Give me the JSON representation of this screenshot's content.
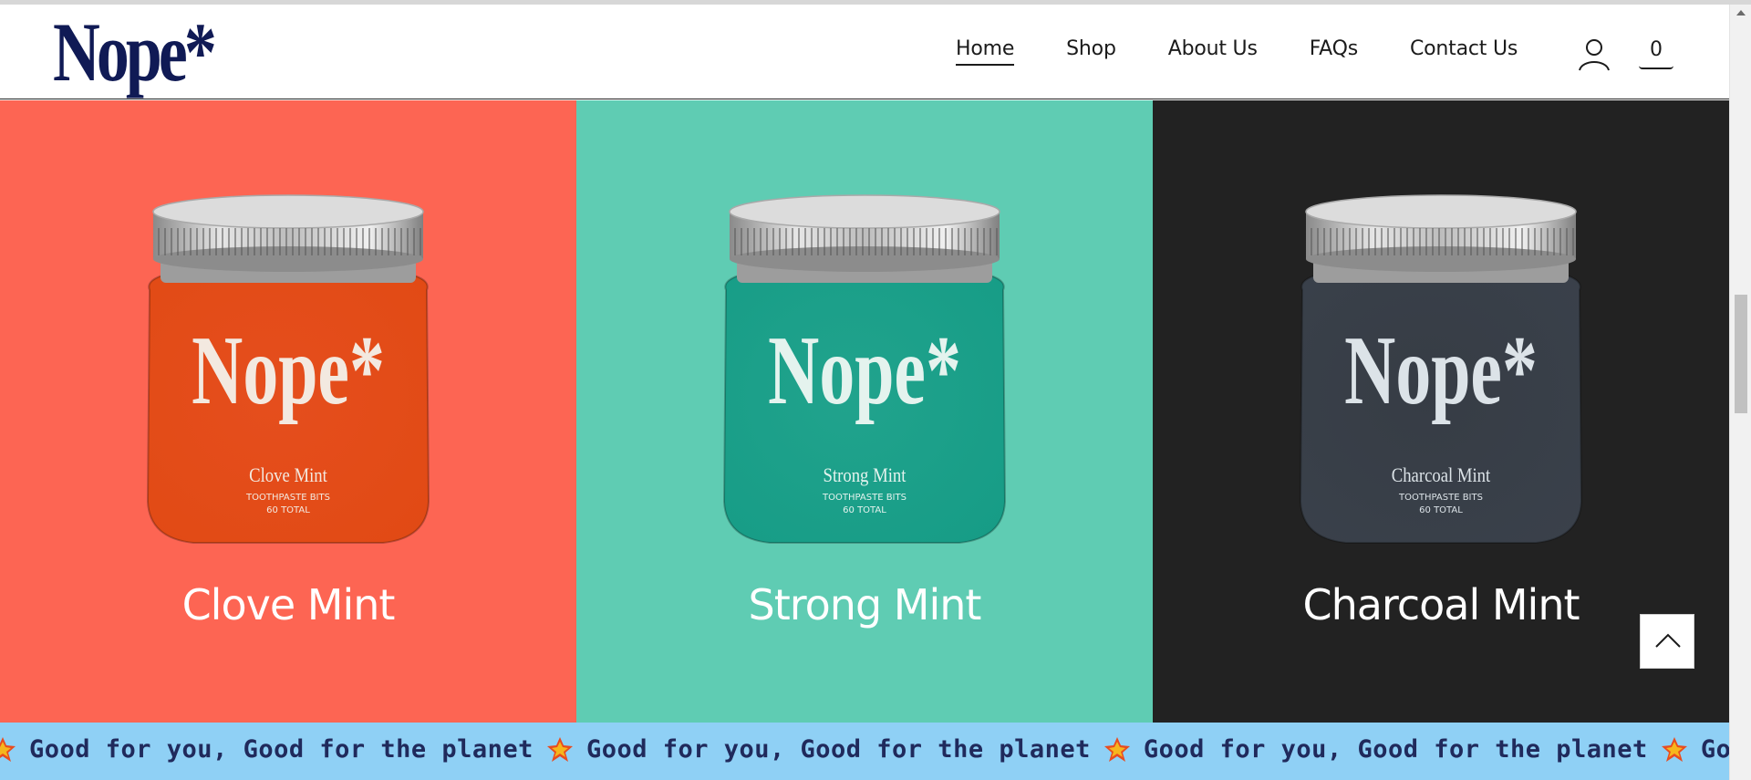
{
  "brand": {
    "name": "Nope*"
  },
  "nav": {
    "items": [
      {
        "label": "Home",
        "active": true
      },
      {
        "label": "Shop",
        "active": false
      },
      {
        "label": "About Us",
        "active": false
      },
      {
        "label": "FAQs",
        "active": false
      },
      {
        "label": "Contact Us",
        "active": false
      }
    ],
    "account_icon": "user-icon",
    "cart_count": "0"
  },
  "products": [
    {
      "name": "Clove Mint",
      "jar_brand": "Nope*",
      "jar_flavor": "Clove Mint",
      "jar_line1": "TOOTHPASTE BITS",
      "jar_line2": "60 TOTAL",
      "bg": "#fd6553",
      "jar_color": "#e14a14",
      "label_color": "#f3e9e0"
    },
    {
      "name": "Strong Mint",
      "jar_brand": "Nope*",
      "jar_flavor": "Strong Mint",
      "jar_line1": "TOOTHPASTE BITS",
      "jar_line2": "60 TOTAL",
      "bg": "#5fccb3",
      "jar_color": "#169c86",
      "label_color": "#e4f3ee"
    },
    {
      "name": "Charcoal Mint",
      "jar_brand": "Nope*",
      "jar_flavor": "Charcoal Mint",
      "jar_line1": "TOOTHPASTE BITS",
      "jar_line2": "60 TOTAL",
      "bg": "#222222",
      "jar_color": "#3a414b",
      "label_color": "#dce3e8"
    }
  ],
  "marquee": {
    "text": "Good for you, Good for the planet",
    "icon": "star-badge-icon",
    "repeat": [
      "Good for you, Good for the planet",
      "Good for you, Good for the planet",
      "Good for you, Good for the planet",
      "Good for you, Good for the planet",
      "Good for you, Good for the planet"
    ]
  },
  "scroll_top": {
    "icon": "chevron-up-icon"
  },
  "colors": {
    "brand_navy": "#101a55",
    "marquee_bg": "#8fd0f5",
    "marquee_text": "#202a5c"
  }
}
